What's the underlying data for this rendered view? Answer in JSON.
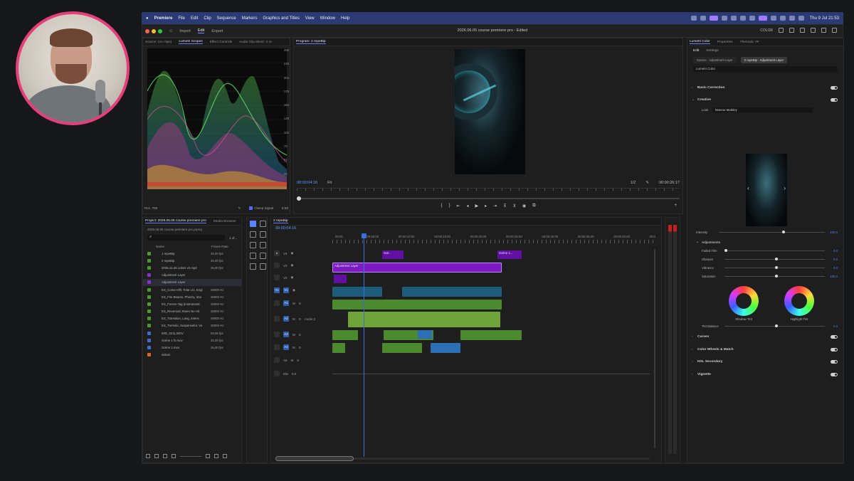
{
  "menubar": {
    "app": "Premiere",
    "items": [
      "File",
      "Edit",
      "Clip",
      "Sequence",
      "Markers",
      "Graphics and Titles",
      "View",
      "Window",
      "Help"
    ],
    "clock": "Thu 9 Jul 21:53"
  },
  "titlebar": {
    "tabs": [
      "Import",
      "Edit",
      "Export"
    ],
    "active_tab": "Edit",
    "title": "2026.06.05 course premiere pro - Edited",
    "workspace": "COLOR"
  },
  "scopes": {
    "tabs": [
      "Source: (no clips)",
      "Lumetri Scopes",
      "Effect Controls",
      "Audio Clip Mixer: 2 re"
    ],
    "scale": [
      "255",
      "230",
      "204",
      "178",
      "153",
      "128",
      "102",
      "76",
      "51",
      "25",
      "0"
    ],
    "scale_right": [
      "100",
      "90",
      "80",
      "70",
      "60",
      "50",
      "40",
      "30",
      "20",
      "10",
      "0"
    ],
    "footer_left": "Rec. 709",
    "clamp": "Clamp Signal",
    "bit": "8 Bit"
  },
  "program": {
    "title": "Program: 2 repeBip",
    "timecode": "00:00:04:16",
    "fit": "Fit",
    "quality": "1/2",
    "duration": "00:00:26:17"
  },
  "project": {
    "tabs": [
      "Project: 2026.06.05 course premiere pro",
      "Media Browser"
    ],
    "path": "2026.06.05 course premiere pro.prproj",
    "count": "1 of...",
    "col_name": "Name",
    "col_rate": "Frame Rate",
    "items": [
      {
        "name": "1 repeBip",
        "rate": "25,00 fps",
        "color": "#4d9b2e"
      },
      {
        "name": "2 repeBip",
        "rate": "25,00 fps",
        "color": "#4d9b2e"
      },
      {
        "name": "2025.12.26 Lobos v2.mp4",
        "rate": "25,00 fps",
        "color": "#4d9b2e"
      },
      {
        "name": "Adjustment Layer",
        "rate": "",
        "color": "#8b2fc9"
      },
      {
        "name": "Adjustment Layer",
        "rate": "",
        "color": "#8b2fc9"
      },
      {
        "name": "ES_Coma Vlift, Tolar LG, Engl",
        "rate": "48000 Hz",
        "color": "#4d9b2e"
      },
      {
        "name": "ES_Fire Beams, Phuzzy, Ima",
        "rate": "48000 Hz",
        "color": "#4d9b2e"
      },
      {
        "name": "ES_Freeze Tag (Instrumentl",
        "rate": "48000 Hz",
        "color": "#4d9b2e"
      },
      {
        "name": "ES_Reversed, Risen No Hit",
        "rate": "48000 Hz",
        "color": "#4d9b2e"
      },
      {
        "name": "ES_Transition, Lang, intens",
        "rate": "48000 Hz",
        "color": "#4d9b2e"
      },
      {
        "name": "ES_Tremolo, Suspenseful, Vo",
        "rate": "48000 Hz",
        "color": "#4d9b2e"
      },
      {
        "name": "IMG_0211.MOV",
        "rate": "59,95 fps",
        "color": "#3f6bd6"
      },
      {
        "name": "Scène 1 fx.mov",
        "rate": "25,00 fps",
        "color": "#3f6bd6"
      },
      {
        "name": "Scène 1.mov",
        "rate": "25,00 fps",
        "color": "#3f6bd6"
      },
      {
        "name": "videos",
        "rate": "",
        "color": "#d46a2c"
      }
    ]
  },
  "timeline": {
    "tab": "2 repeBip",
    "timecode": "00:00:04:16",
    "ruler": [
      "00:00",
      "00:00:05:00",
      "00:00:10:00",
      "00:00:15:00",
      "00:00:20:00",
      "00:00:25:00",
      "00:00:30:00",
      "00:00:35:00",
      "00:00:40:00",
      "00:0"
    ],
    "tracks": [
      "V4",
      "V3",
      "V2",
      "V1",
      "A1",
      "A2",
      "A3",
      "A4",
      "A5",
      "Mix"
    ],
    "audio_label": "Audio 2",
    "mix_value": "0.0",
    "clip_adjustment": "Adjustment Layer",
    "clip_sce": "Scè..",
    "clip_scene": "Scène 1..."
  },
  "lumetri": {
    "tabs": [
      "Lumetri Color",
      "Properties",
      "Thematic VF"
    ],
    "subtabs": [
      "Edit",
      "Settings"
    ],
    "source_master": "Source · Adjustment Layer",
    "source_clip": "2 repeBip · Adjustment Layer",
    "preset": "Lumetri Color",
    "sections": [
      "Basic Correction",
      "Creative",
      "Curves",
      "Color Wheels & Match",
      "HSL Secondary",
      "Vignette"
    ],
    "look_label": "Look",
    "look_value": "Monroe Markley",
    "intensity_label": "Intensity",
    "intensity_value": "100.0",
    "adjustments_label": "Adjustments",
    "sliders": [
      {
        "label": "Faded Film",
        "value": "0.0",
        "pos": 0.0
      },
      {
        "label": "Sharpen",
        "value": "0.0",
        "pos": 0.5
      },
      {
        "label": "Vibrance",
        "value": "0.0",
        "pos": 0.5
      },
      {
        "label": "Saturation",
        "value": "100.0",
        "pos": 0.5
      }
    ],
    "shadow_tint": "Shadow Tint",
    "highlight_tint": "Highlight Tint",
    "tint_balance": "Tint Balance",
    "tint_balance_value": "0.0"
  }
}
